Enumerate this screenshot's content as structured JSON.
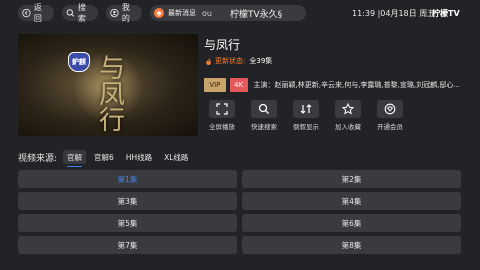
{
  "topbar": {
    "back_label": "返回",
    "search_label": "搜索",
    "mine_label": "我的",
    "notice_label": "最新消息",
    "notice_scroll": "ou",
    "notice_scroll2": "柠檬TV永久§",
    "clock": "11:39 |04月18日 周五",
    "brand": "柠檬TV"
  },
  "poster": {
    "badge": "鈩麒",
    "art_text": "与凤行"
  },
  "detail": {
    "title": "与凤行",
    "status_label": "更新状态:",
    "episodes": "全39集",
    "tag_vip": "VIP",
    "tag_4k": "4K",
    "cast": "主演：赵丽颖,林更新,辛云来,何与,李露璐,普黎,宣璐,刘冠麟,邸心..."
  },
  "actions": [
    {
      "label": "全屏播放",
      "icon": "fullscreen-icon"
    },
    {
      "label": "快速搜索",
      "icon": "search-icon"
    },
    {
      "label": "倒叙显示",
      "icon": "sort-icon"
    },
    {
      "label": "加入收藏",
      "icon": "star-icon"
    },
    {
      "label": "开通会员",
      "icon": "vip-icon"
    }
  ],
  "source": {
    "title": "视频来源:",
    "tabs": [
      "官解",
      "官解6",
      "HH线路",
      "XL线路"
    ],
    "active_index": 0
  },
  "episode_list": [
    "第1集",
    "第2集",
    "第3集",
    "第4集",
    "第5集",
    "第6集",
    "第7集",
    "第8集"
  ],
  "active_episode": 0,
  "colors": {
    "accent": "#3b82f6",
    "status": "#ff7a2e",
    "vip": "#c9a46a",
    "tag4k": "#e5595c"
  }
}
